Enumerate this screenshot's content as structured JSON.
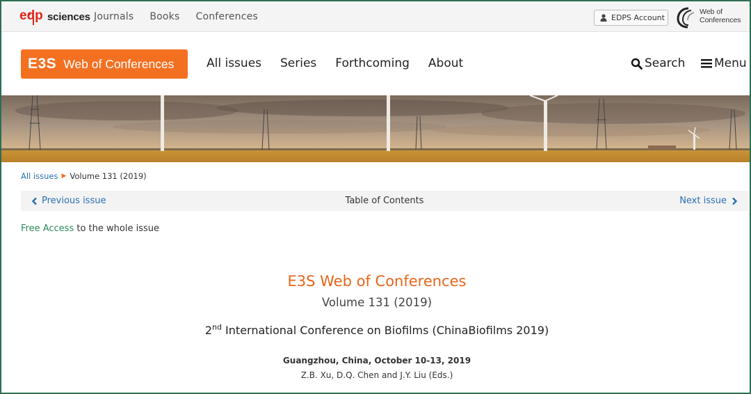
{
  "topbar": {
    "logo_text": "sciences",
    "links": [
      "Journals",
      "Books",
      "Conferences"
    ],
    "account_label": "EDPS Account",
    "wof_logo_line1": "Web of",
    "wof_logo_line2": "Conferences"
  },
  "nav": {
    "brand_short": "E3S",
    "brand_long": "Web of Conferences",
    "links": [
      "All issues",
      "Series",
      "Forthcoming",
      "About"
    ],
    "search_label": "Search",
    "menu_label": "Menu",
    "brand_color": "#f37021"
  },
  "breadcrumb": {
    "root": "All issues",
    "current": "Volume 131 (2019)"
  },
  "toc": {
    "prev_label": "Previous issue",
    "title": "Table of Contents",
    "next_label": "Next issue"
  },
  "access": {
    "highlight": "Free Access",
    "rest": " to the whole issue"
  },
  "issue": {
    "journal": "E3S Web of Conferences",
    "volume": "Volume 131 (2019)",
    "conf_ordinal": "2",
    "conf_ordinal_suffix": "nd",
    "conf_name": " International Conference on Biofilms (ChinaBiofilms 2019)",
    "location": "Guangzhou, China, October 10-13, 2019",
    "editors": "Z.B. Xu, D.Q. Chen and J.Y. Liu (Eds.)"
  },
  "icons": {
    "user": "user-icon",
    "search": "search-icon",
    "menu": "hamburger-icon",
    "prev": "chevron-left-icon",
    "next": "chevron-right-icon",
    "crumb": "caret-right-icon"
  }
}
